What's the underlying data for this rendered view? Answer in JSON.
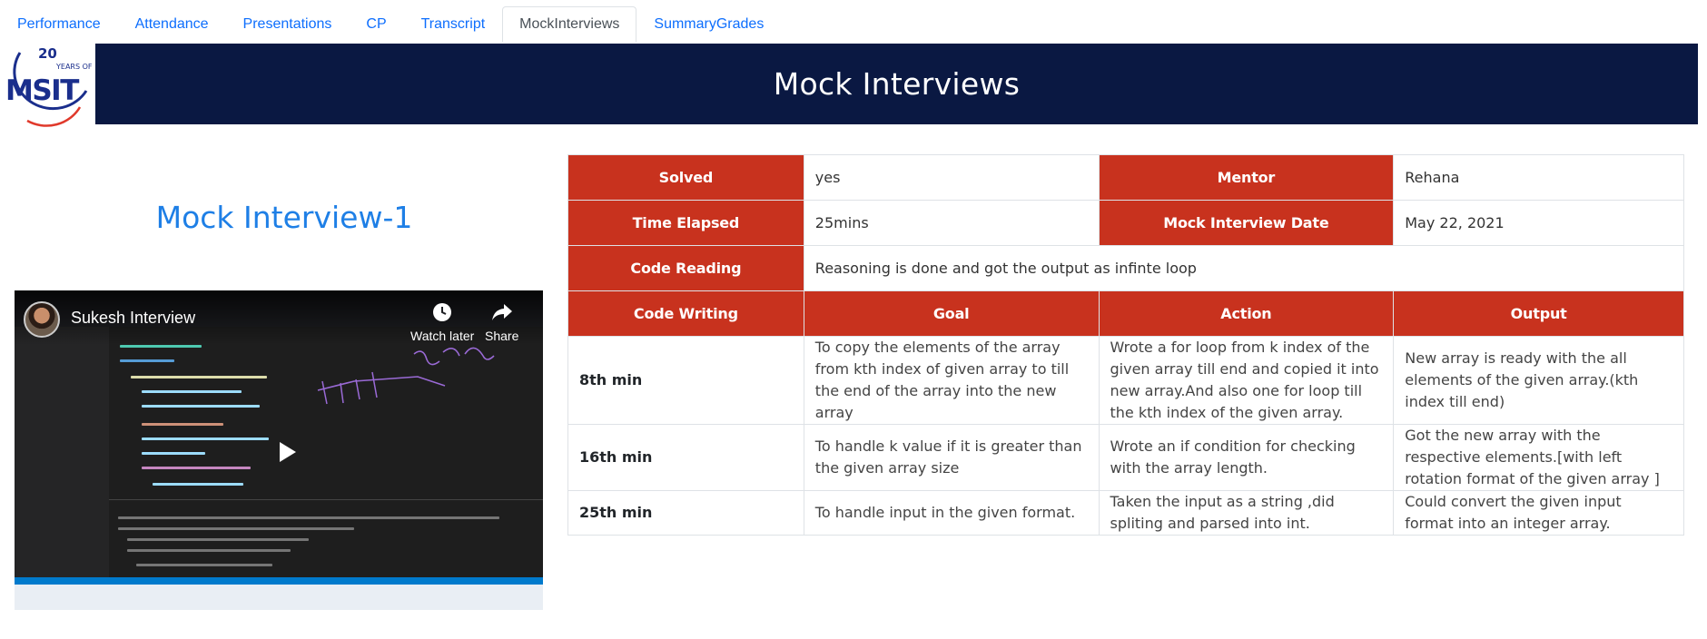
{
  "tabs": [
    "Performance",
    "Attendance",
    "Presentations",
    "CP",
    "Transcript",
    "MockInterviews",
    "SummaryGrades"
  ],
  "active_tab": "MockInterviews",
  "logo": {
    "years": "20",
    "years_label": "YEARS OF",
    "name": "MSIT"
  },
  "banner": {
    "title": "Mock Interviews"
  },
  "left": {
    "title": "Mock Interview-1",
    "video": {
      "title": "Sukesh Interview",
      "watch_later": "Watch later",
      "share": "Share"
    }
  },
  "colors": {
    "header_bg": "#0a1842",
    "table_header": "#c8321e",
    "link": "#1e7fe6"
  },
  "table": {
    "solved_label": "Solved",
    "solved_value": "yes",
    "mentor_label": "Mentor",
    "mentor_value": "Rehana",
    "time_label": "Time Elapsed",
    "time_value": "25mins",
    "date_label": "Mock Interview Date",
    "date_value": "May 22, 2021",
    "reading_label": "Code Reading",
    "reading_value": "Reasoning is done and got the output as infinte loop",
    "columns": [
      "Code Writing",
      "Goal",
      "Action",
      "Output"
    ],
    "rows": [
      {
        "time": "8th min",
        "goal": "To copy the elements of the array from kth index of given array to till the end of the array into the new array",
        "action": "Wrote a for loop from k index of the given array till end and copied it into new array.And also one for loop till the kth index of the given array.",
        "output": "New array is ready with the all elements of the given array.(kth index till end)"
      },
      {
        "time": "16th min",
        "goal": "To handle k value if it is greater than the given array size",
        "action": "Wrote an if condition for checking with the array length.",
        "output": "Got the new array with the respective elements.[with left rotation format of the given array ]"
      },
      {
        "time": "25th min",
        "goal": "To handle input in the given format.",
        "action": "Taken the input as a string ,did spliting and parsed into int.",
        "output": "Could convert the given input format into an integer array."
      }
    ]
  }
}
